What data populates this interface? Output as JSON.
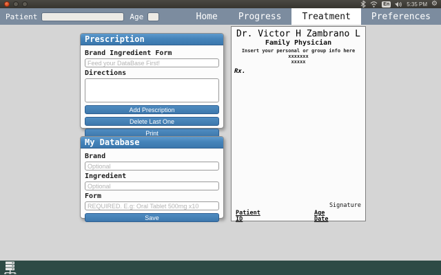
{
  "titlebar": {
    "window_buttons": [
      "close",
      "minimize",
      "maximize"
    ],
    "tray": {
      "icons": [
        "bluetooth-icon",
        "wifi-icon",
        "keyboard-indicator",
        "volume-icon",
        "session-gear-icon"
      ],
      "keyboard_layout": "En",
      "time": "5:35 PM"
    }
  },
  "navbar": {
    "patient_label": "Patient",
    "patient_value": "",
    "age_label": "Age",
    "age_value": "",
    "tabs": [
      {
        "label": "Home",
        "active": false
      },
      {
        "label": "Progress",
        "active": false
      },
      {
        "label": "Treatment",
        "active": true
      },
      {
        "label": "Preferences",
        "active": false
      }
    ]
  },
  "prescription_panel": {
    "title": "Prescription",
    "brand_label": "Brand Ingredient Form",
    "brand_value": "",
    "brand_placeholder": "Feed your DataBase First!",
    "directions_label": "Directions",
    "directions_value": "",
    "buttons": [
      "Add Prescription",
      "Delete Last One",
      "Print"
    ]
  },
  "database_panel": {
    "title": "My Database",
    "fields": [
      {
        "label": "Brand",
        "value": "",
        "placeholder": "Optional"
      },
      {
        "label": "Ingredient",
        "value": "",
        "placeholder": "Optional"
      },
      {
        "label": "Form",
        "value": "",
        "placeholder": "REQUIRED. E.g: Oral Tablet 500mg x10"
      }
    ],
    "save_label": "Save"
  },
  "paper": {
    "doctor_name": "Dr. Victor H Zambrano L",
    "specialty": "Family Physician",
    "info_line": "Insert your personal or group info here",
    "info_placeholder1": "xxxxxxx",
    "info_placeholder2": "xxxxx",
    "rx_label": "Rx.",
    "signature_label": "Signature",
    "patient_label": "Patient",
    "age_label": "Age",
    "id_label": "ID",
    "date_label": "Date"
  },
  "colors": {
    "accent_blue": "#3d77ac",
    "panel_header_blue": "#4584ba",
    "navbar_slate": "#7c8c9f",
    "content_background": "#d5d5d5",
    "bottom_bar_teal": "#2d4a45",
    "close_button_orange": "#d8481d"
  }
}
